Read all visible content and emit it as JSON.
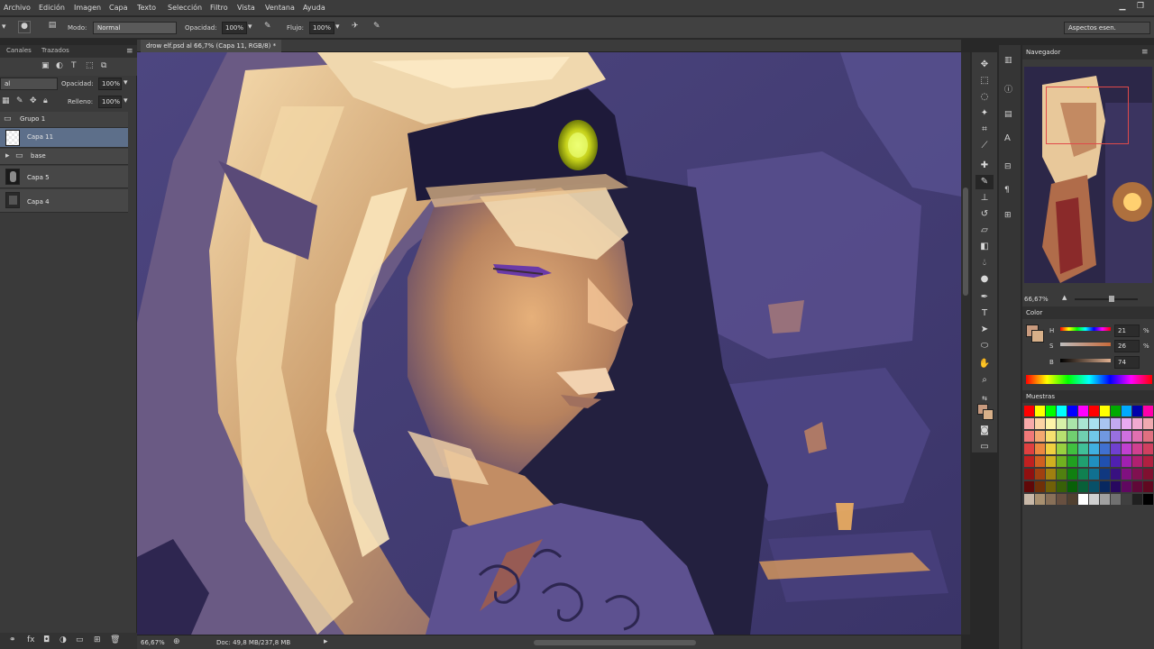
{
  "menu": [
    "Archivo",
    "Edición",
    "Imagen",
    "Capa",
    "Texto",
    "Selección",
    "Filtro",
    "Vista",
    "Ventana",
    "Ayuda"
  ],
  "options": {
    "mode_label": "Modo:",
    "mode_value": "Normal",
    "opacity_label": "Opacidad:",
    "opacity_value": "100%",
    "flow_label": "Flujo:",
    "flow_value": "100%",
    "workspace": "Aspectos esen."
  },
  "layers_panel": {
    "tabs": [
      "Canales",
      "Trazados"
    ],
    "blend_value": "al",
    "opacity_label": "Opacidad:",
    "opacity_value": "100%",
    "fill_label": "Relleno:",
    "fill_value": "100%",
    "layers": [
      "Grupo 1",
      "Capa 11",
      "base",
      "Capa 5",
      "Capa 4"
    ]
  },
  "document": {
    "tab_title": "drow elf.psd al 66,7% (Capa 11, RGB/8) *",
    "zoom": "66,67%",
    "doc_info": "Doc: 49,8 MB/237,8 MB"
  },
  "navigator": {
    "title": "Navegador",
    "zoom": "66,67%"
  },
  "color": {
    "title": "Color",
    "h_label": "H",
    "h_value": "21",
    "s_label": "S",
    "s_value": "26",
    "b_label": "B",
    "b_value": "74",
    "foreground": "#c89a7e",
    "background": "#d8b089"
  },
  "swatches": {
    "title": "Muestras",
    "colors": [
      "#ff0000",
      "#ffff00",
      "#00ff00",
      "#00ffff",
      "#0000ff",
      "#ff00ff",
      "#ff0000",
      "#ffff00",
      "#00aa00",
      "#00aaff",
      "#0000aa",
      "#ff00aa",
      "#f7a9a9",
      "#fcd3a4",
      "#fdf4a8",
      "#d7f0a8",
      "#a9e5a9",
      "#a9e5d2",
      "#a9e0f0",
      "#a9c4f0",
      "#c3a9f0",
      "#e8a9f0",
      "#f0a9d0",
      "#f0a9b0",
      "#f07878",
      "#f4a870",
      "#f7e070",
      "#b8e070",
      "#70d070",
      "#70d0b0",
      "#70c8e8",
      "#7098e0",
      "#9870e0",
      "#d070e0",
      "#e070b0",
      "#e07080",
      "#e04040",
      "#ec8840",
      "#f0d040",
      "#98d040",
      "#40c040",
      "#40c098",
      "#40b0e0",
      "#4070d0",
      "#7040d0",
      "#c040d0",
      "#d04090",
      "#d04060",
      "#c02020",
      "#d06020",
      "#d0b020",
      "#70b020",
      "#20a020",
      "#20a070",
      "#2090c0",
      "#2050b0",
      "#5020b0",
      "#a020b0",
      "#b02070",
      "#b02040",
      "#901010",
      "#a04010",
      "#a08010",
      "#508010",
      "#108010",
      "#108050",
      "#107090",
      "#103880",
      "#381080",
      "#801080",
      "#801050",
      "#801030",
      "#600808",
      "#703008",
      "#706008",
      "#386008",
      "#086008",
      "#086038",
      "#085068",
      "#082860",
      "#280860",
      "#600860",
      "#600838",
      "#600820",
      "#c8b8a8",
      "#a89070",
      "#887058",
      "#685040",
      "#504030",
      "#ffffff",
      "#d0d0d0",
      "#a0a0a0",
      "#707070",
      "#404040",
      "#202020",
      "#000000"
    ]
  }
}
